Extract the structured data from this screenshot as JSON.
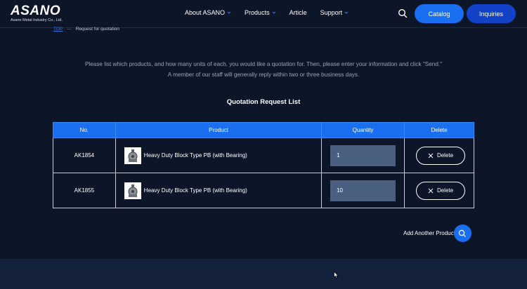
{
  "header": {
    "logo_text": "ASANO",
    "logo_subtitle": "Asano Metal Industry Co., Ltd.",
    "nav": [
      {
        "label": "About ASANO",
        "has_dropdown": true
      },
      {
        "label": "Products",
        "has_dropdown": true
      },
      {
        "label": "Article",
        "has_dropdown": false
      },
      {
        "label": "Support",
        "has_dropdown": true
      }
    ],
    "search_icon": "search-icon",
    "catalog_label": "Catalog",
    "inquiries_label": "Inquiries"
  },
  "breadcrumb": {
    "home": "TOP",
    "separator": "—",
    "current": "Request for quotation"
  },
  "intro": {
    "line1": "Please list which products, and how many units of each, you would like a quotation for. Then, please enter your information and click \"Send.\"",
    "line2": "A member of our staff will generally reply within two or three business days."
  },
  "quotation": {
    "title": "Quotation Request List",
    "columns": {
      "no": "No.",
      "product": "Product",
      "quantity": "Quantity",
      "delete": "Delete"
    },
    "rows": [
      {
        "no": "AK1854",
        "product": "Heavy Duty Block Type PB (with Bearing)",
        "quantity": "1",
        "delete_label": "Delete"
      },
      {
        "no": "AK1855",
        "product": "Heavy Duty Block Type PB (with Bearing)",
        "quantity": "10",
        "delete_label": "Delete"
      }
    ],
    "add_another_label": "Add Another Product"
  },
  "colors": {
    "background": "#0d1628",
    "accent": "#1a6ff0",
    "accent_dark": "#1242c8",
    "input_bg": "#4a5f7f"
  }
}
